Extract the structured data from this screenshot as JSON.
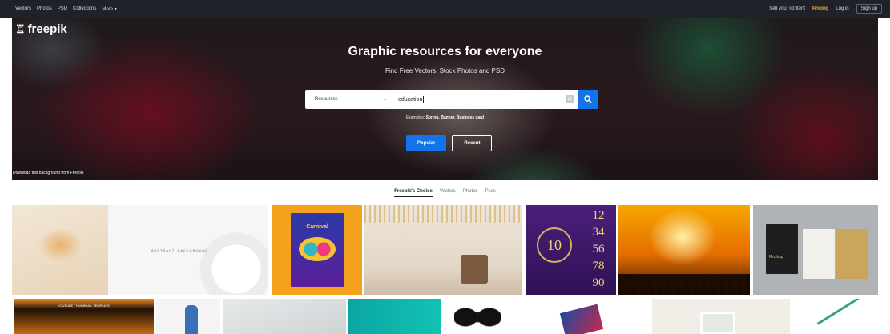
{
  "topnav": {
    "left_links": [
      "Vectors",
      "Photos",
      "PSD",
      "Collections",
      "More ▾"
    ],
    "sell": "Sell your content",
    "pricing": "Pricing",
    "login": "Log in",
    "signup": "Sign up"
  },
  "hero": {
    "logo": "freepik",
    "title": "Graphic resources for everyone",
    "subtitle": "Find Free Vectors, Stock Photos and PSD",
    "search": {
      "filter": "Resources",
      "query": "education"
    },
    "examples_prefix": "Examples:",
    "examples": "Spring, Banner, Business card",
    "pills": [
      "Popular",
      "Recent"
    ],
    "credit": "Download this background from Freepik"
  },
  "tabs": [
    "Freepik's Choice",
    "Vectors",
    "Photos",
    "Psds"
  ],
  "thumbs": {
    "t2_text": "ABSTRACT_BACKGROUND",
    "t3_title": "Carnival",
    "t5_ten": "10",
    "t5_numbers": [
      "12",
      "34",
      "56",
      "78",
      "90"
    ],
    "t7_label": "Mockup",
    "u1_label": "YOUTUBE THUMBNAIL TEMPLATE"
  },
  "colors": {
    "accent": "#1273eb",
    "pricing": "#f2b33d",
    "topbar": "#1f2329"
  }
}
